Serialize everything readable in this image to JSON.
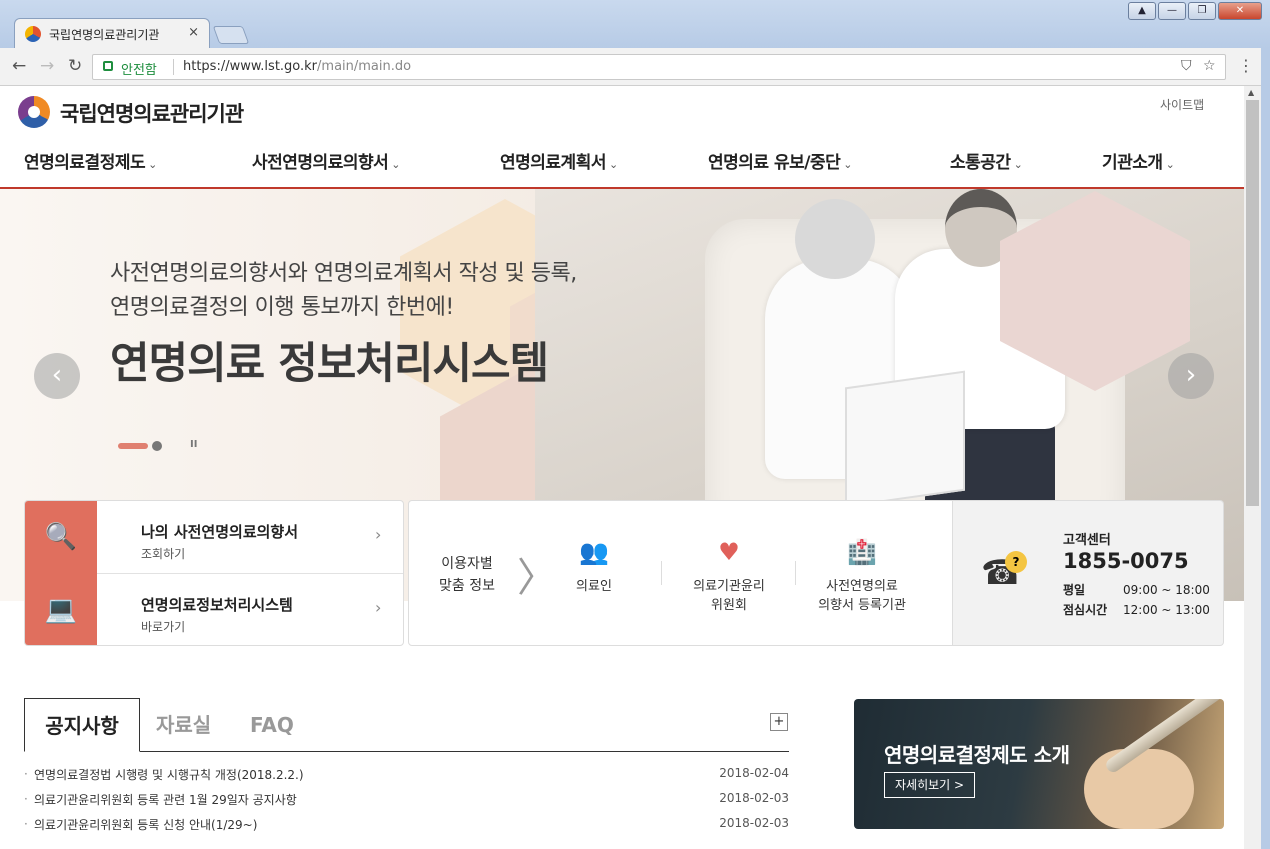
{
  "browser": {
    "tab_title": "국립연명의료관리기관",
    "tab_close": "×",
    "secure_label": "안전함",
    "url_base": "https://www.lst.go.kr",
    "url_path": "/main/main.do",
    "window_buttons": [
      "▲",
      "—",
      "❐",
      "✕"
    ]
  },
  "header": {
    "site_name": "국립연명의료관리기관",
    "sitemap": "사이트맵"
  },
  "gnb": [
    {
      "label": "연명의료결정제도"
    },
    {
      "label": "사전연명의료의향서"
    },
    {
      "label": "연명의료계획서"
    },
    {
      "label": "연명의료 유보/중단"
    },
    {
      "label": "소통공간"
    },
    {
      "label": "기관소개"
    }
  ],
  "hero": {
    "sub_line1": "사전연명의료의향서와 연명의료계획서 작성 및 등록,",
    "sub_line2": "연명의료결정의 이행 통보까지 한번에!",
    "title": "연명의료 정보처리시스템",
    "prev": "‹",
    "next": "›",
    "pause": "II"
  },
  "quick_links": [
    {
      "title": "나의 사전연명의료의향서",
      "sub": "조회하기",
      "icon": "id-search-icon"
    },
    {
      "title": "연명의료정보처리시스템",
      "sub": "바로가기",
      "icon": "laptop-cursor-icon"
    }
  ],
  "user_info": {
    "label_line1": "이용자별",
    "label_line2": "맞춤 정보",
    "items": [
      {
        "line1": "의료인",
        "line2": "",
        "icon": "medical-staff-icon"
      },
      {
        "line1": "의료기관윤리",
        "line2": "위원회",
        "icon": "heart-hand-icon"
      },
      {
        "line1": "사전연명의료",
        "line2": "의향서 등록기관",
        "icon": "hospital-icon"
      }
    ]
  },
  "customer_center": {
    "title": "고객센터",
    "phone": "1855-0075",
    "hours": [
      {
        "label": "평일",
        "value": "09:00 ~ 18:00"
      },
      {
        "label": "점심시간",
        "value": "12:00 ~ 13:00"
      }
    ]
  },
  "notice": {
    "tabs": [
      "공지사항",
      "자료실",
      "FAQ"
    ],
    "more": "+",
    "items": [
      {
        "title": "연명의료결정법 시행령 및 시행규칙 개정(2018.2.2.)",
        "date": "2018-02-04"
      },
      {
        "title": "의료기관윤리위원회 등록 관련 1월 29일자 공지사항",
        "date": "2018-02-03"
      },
      {
        "title": "의료기관윤리위원회 등록 신청 안내(1/29~)",
        "date": "2018-02-03"
      }
    ]
  },
  "banner": {
    "title": "연명의료결정제도 소개",
    "more": "자세히보기 >"
  },
  "colors": {
    "accent": "#c0392b",
    "quick_icon_bg": "#e06f5e"
  }
}
